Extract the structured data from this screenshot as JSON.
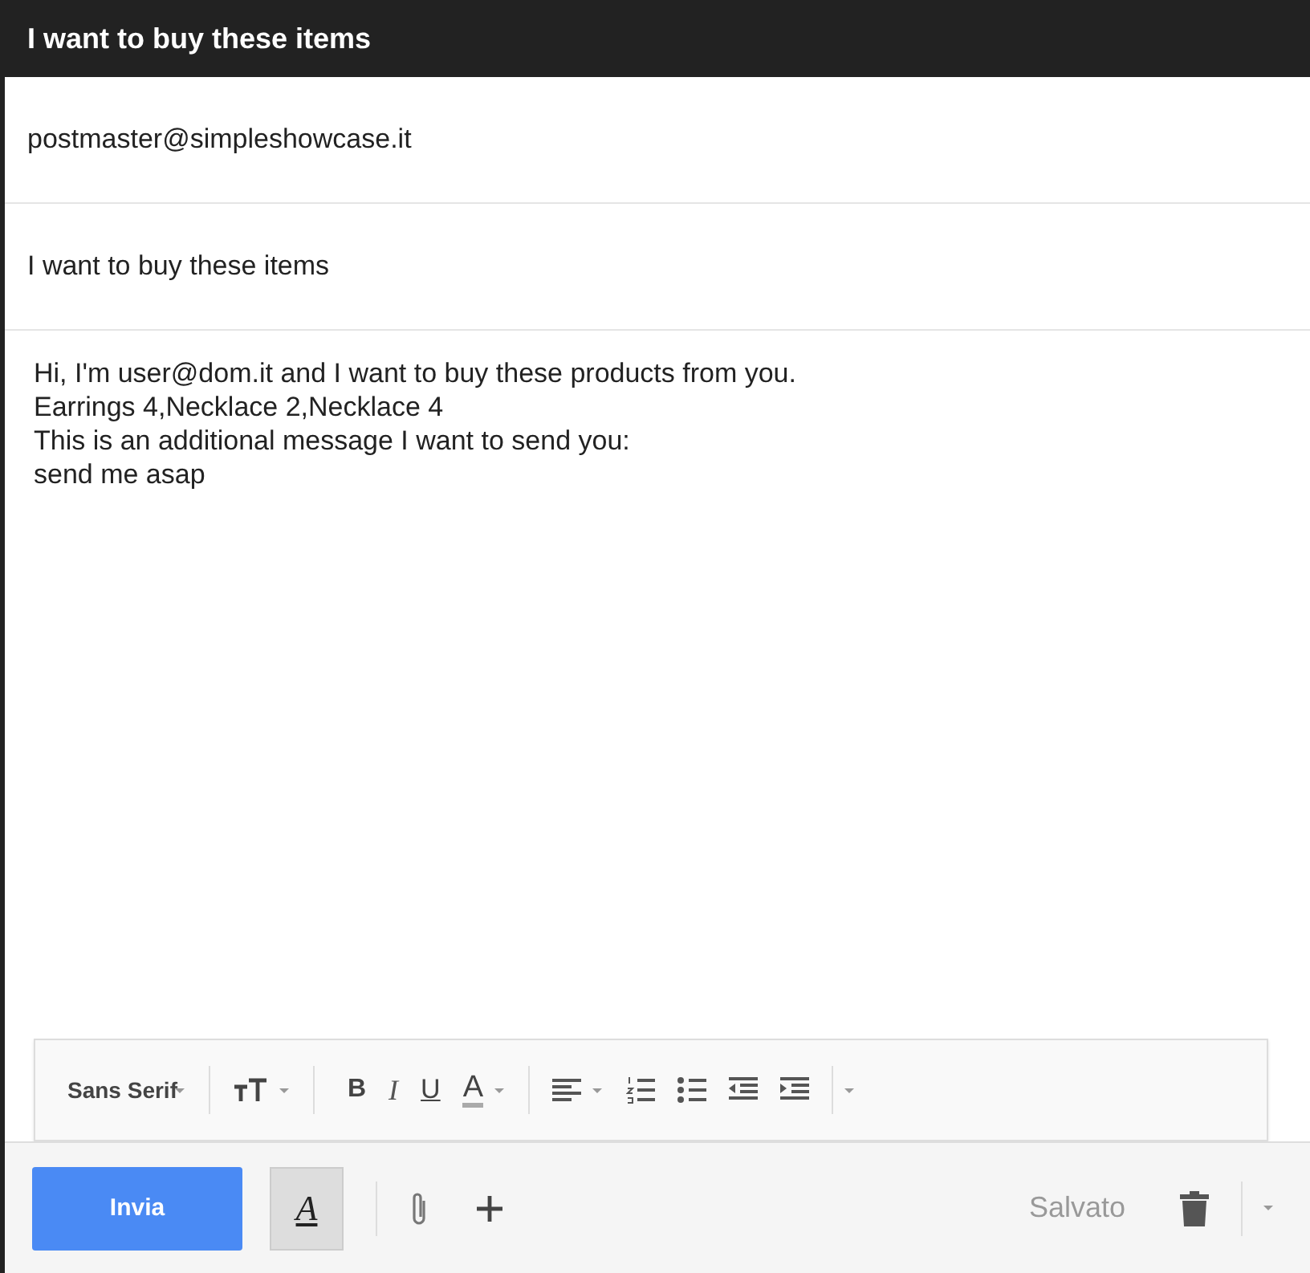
{
  "window": {
    "title": "I want to buy these items"
  },
  "recipient": {
    "value": "postmaster@simpleshowcase.it"
  },
  "subject": {
    "value": "I want to buy these items"
  },
  "body": {
    "lines": [
      "Hi, I'm user@dom.it and I want to buy these products from you.",
      "Earrings 4,Necklace 2,Necklace 4",
      "This is an additional message I want to send you:",
      "send me asap"
    ]
  },
  "format_toolbar": {
    "font": "Sans Serif",
    "bold": "B",
    "italic": "I",
    "underline": "U",
    "text_color": "A"
  },
  "bottom_bar": {
    "send": "Invia",
    "format_toggle": {
      "label": "A",
      "selected": true
    },
    "status": "Salvato"
  }
}
